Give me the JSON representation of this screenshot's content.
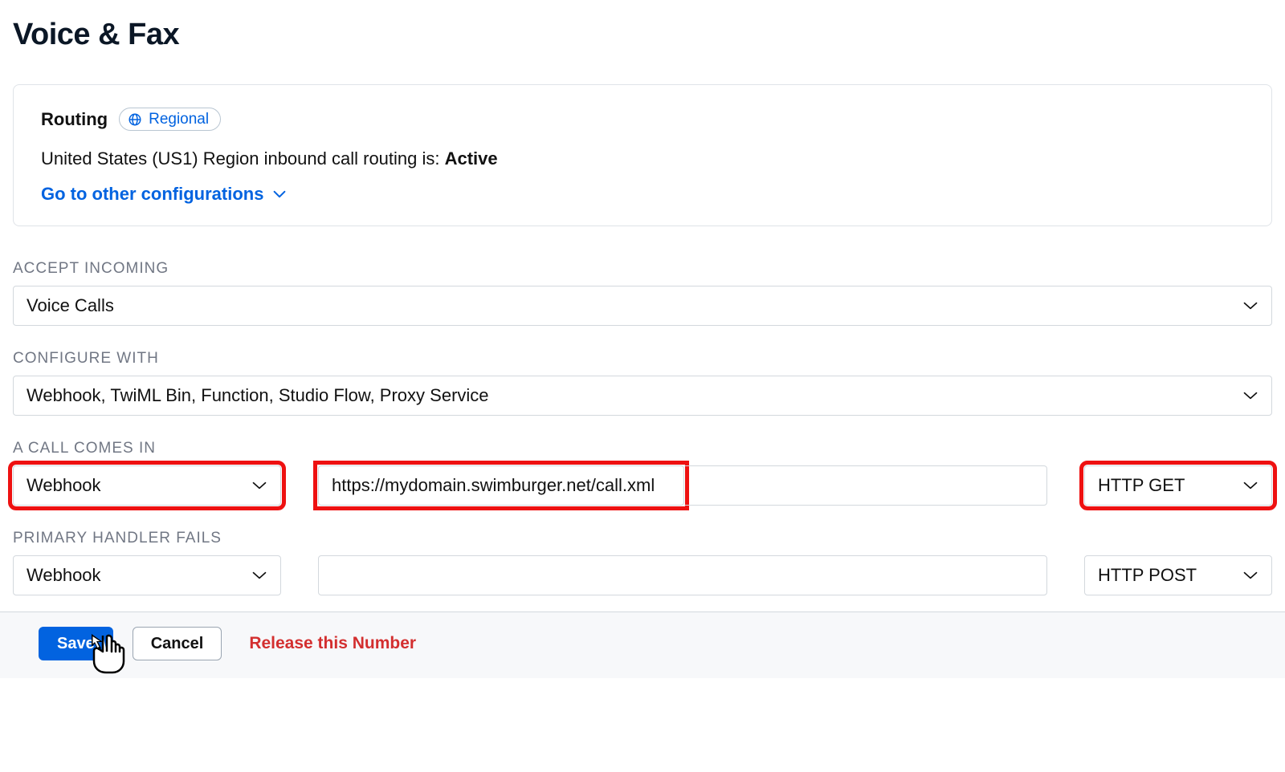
{
  "page": {
    "title": "Voice & Fax"
  },
  "routing": {
    "title": "Routing",
    "pill": "Regional",
    "status_prefix": "United States (US1) Region inbound call routing is: ",
    "status_value": "Active",
    "other_config": "Go to other configurations"
  },
  "accept_incoming": {
    "label": "ACCEPT INCOMING",
    "value": "Voice Calls"
  },
  "configure_with": {
    "label": "CONFIGURE WITH",
    "value": "Webhook, TwiML Bin, Function, Studio Flow, Proxy Service"
  },
  "call_comes_in": {
    "label": "A CALL COMES IN",
    "handler": "Webhook",
    "url": "https://mydomain.swimburger.net/call.xml",
    "method": "HTTP GET"
  },
  "primary_handler_fails": {
    "label": "PRIMARY HANDLER FAILS",
    "handler": "Webhook",
    "url": "",
    "method": "HTTP POST"
  },
  "footer": {
    "save": "Save",
    "cancel": "Cancel",
    "release": "Release this Number"
  }
}
